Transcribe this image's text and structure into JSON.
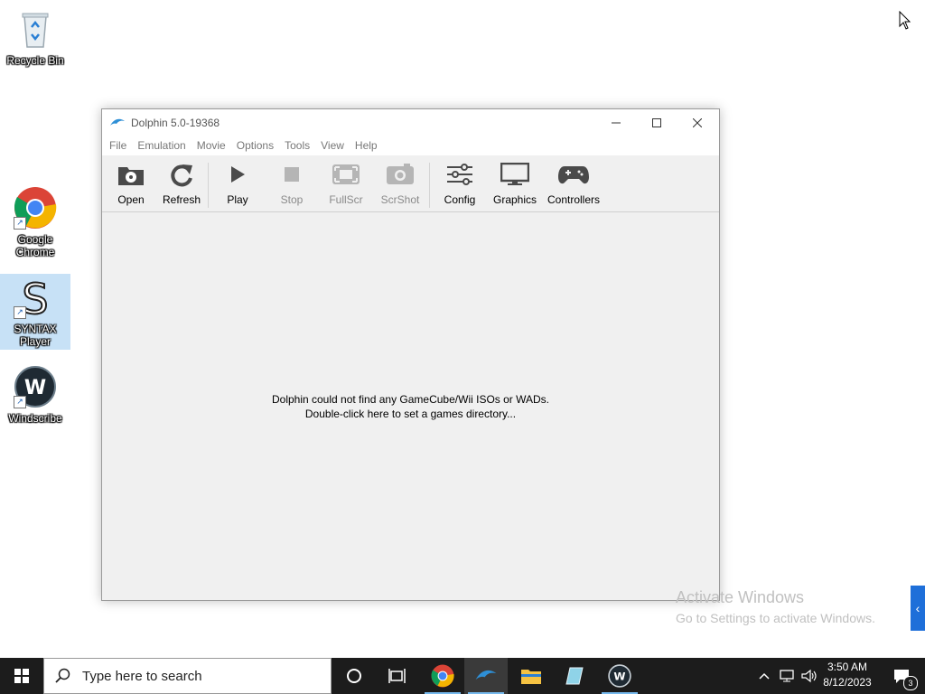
{
  "desktop": {
    "icons": [
      {
        "label": "Recycle Bin"
      },
      {
        "label": "Google Chrome"
      },
      {
        "label": "SYNTAX Player"
      },
      {
        "label": "Windscribe"
      }
    ],
    "watermark": {
      "line1": "Activate Windows",
      "line2": "Go to Settings to activate Windows."
    }
  },
  "window": {
    "title": "Dolphin 5.0-19368",
    "menu": [
      "File",
      "Emulation",
      "Movie",
      "Options",
      "Tools",
      "View",
      "Help"
    ],
    "toolbar": [
      {
        "label": "Open",
        "icon": "open-disc-icon",
        "enabled": true
      },
      {
        "label": "Refresh",
        "icon": "refresh-icon",
        "enabled": true
      },
      {
        "label": "Play",
        "icon": "play-icon",
        "enabled": true
      },
      {
        "label": "Stop",
        "icon": "stop-icon",
        "enabled": false
      },
      {
        "label": "FullScr",
        "icon": "fullscreen-icon",
        "enabled": false
      },
      {
        "label": "ScrShot",
        "icon": "camera-icon",
        "enabled": false
      },
      {
        "label": "Config",
        "icon": "sliders-icon",
        "enabled": true
      },
      {
        "label": "Graphics",
        "icon": "monitor-icon",
        "enabled": true
      },
      {
        "label": "Controllers",
        "icon": "gamepad-icon",
        "enabled": true
      }
    ],
    "message": {
      "line1": "Dolphin could not find any GameCube/Wii ISOs or WADs.",
      "line2": "Double-click here to set a games directory..."
    }
  },
  "taskbar": {
    "search_placeholder": "Type here to search",
    "clock": {
      "time": "3:50 AM",
      "date": "8/12/2023"
    },
    "notification_count": "3"
  },
  "colors": {
    "taskbar": "#1c1c1c",
    "accent": "#1e6fd9",
    "active_indicator": "#76b9ed"
  }
}
